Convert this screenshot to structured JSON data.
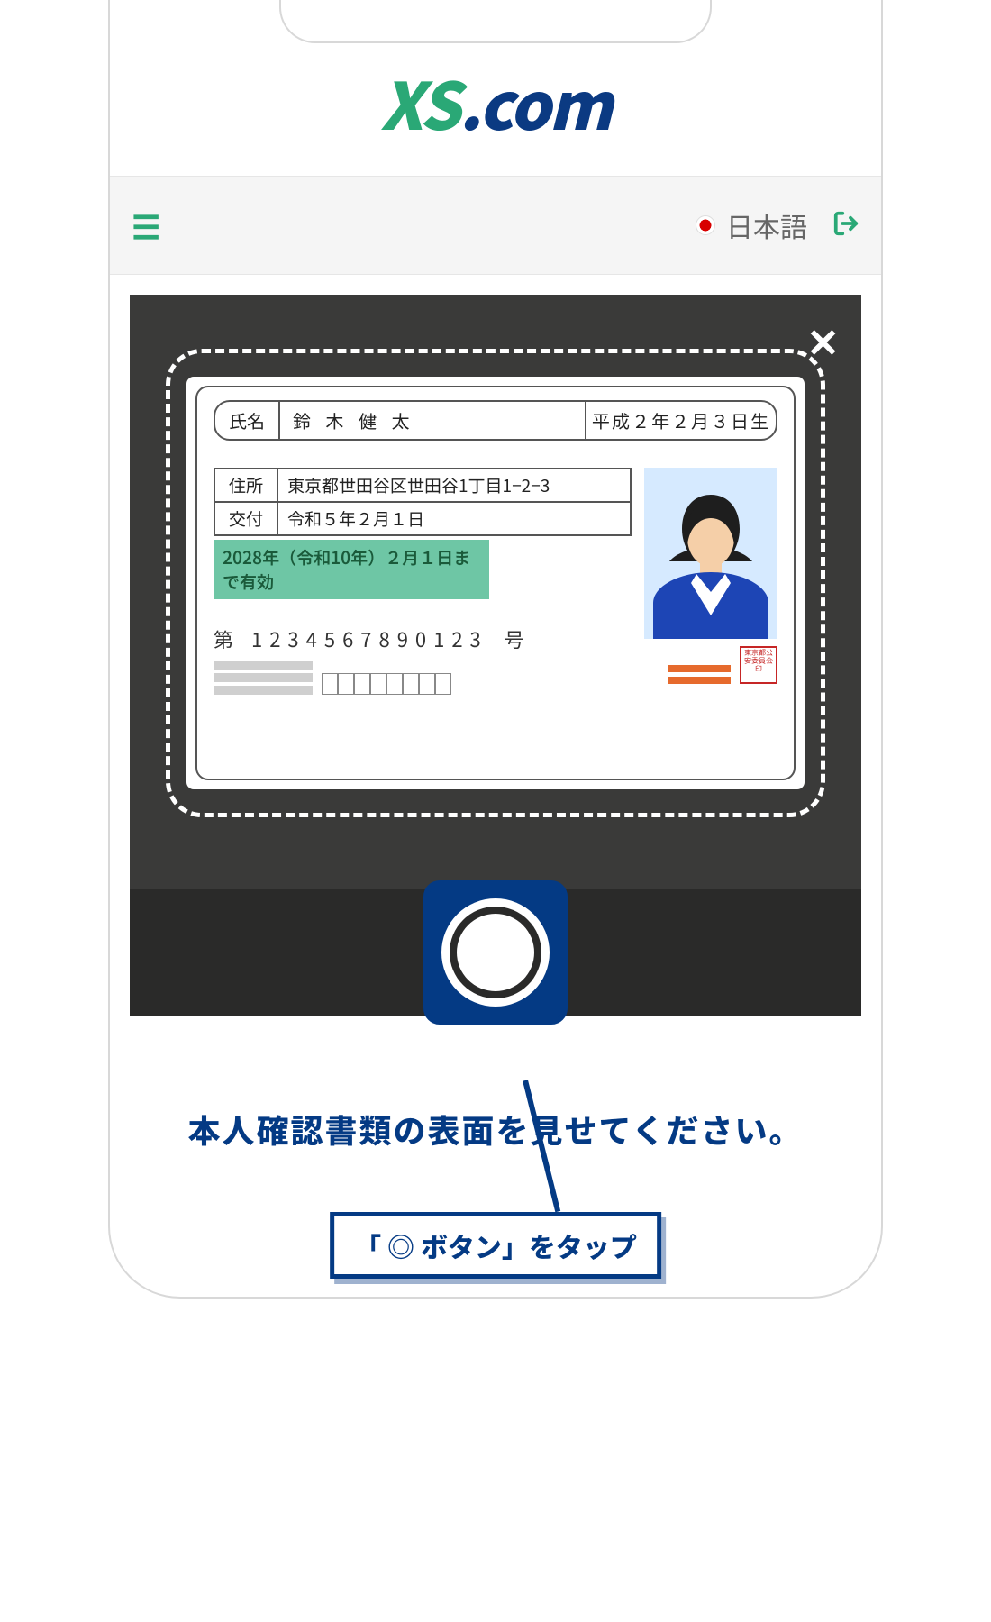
{
  "brand": {
    "xs": "XS",
    "dotcom": ".com"
  },
  "topbar": {
    "language": "日本語"
  },
  "id_card": {
    "name_label": "氏名",
    "name": "鈴 木 健 太",
    "dob": "平成２年２月３日生",
    "address_label": "住所",
    "address": "東京都世田谷区世田谷1丁目1−2−3",
    "issue_label": "交付",
    "issue": "令和５年２月１日",
    "validity": "2028年（令和10年）２月１日まで有効",
    "num_prefix": "第",
    "number": "1234567890123",
    "num_suffix": "号",
    "seal": "東京都公安委員会印"
  },
  "instruction": "本人確認書類の表面を見せてください。",
  "callout": "「 ◎ ボタン」をタップ"
}
